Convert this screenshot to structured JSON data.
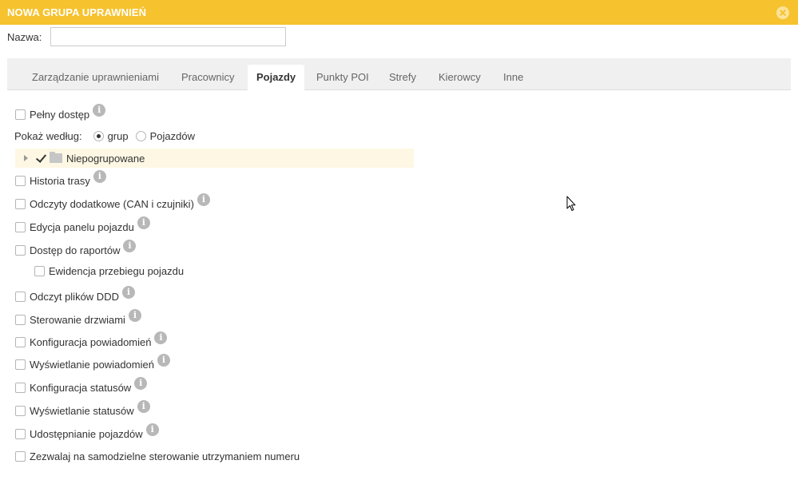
{
  "dialog": {
    "title": "NOWA GRUPA UPRAWNIEŃ",
    "name_label": "Nazwa:",
    "name_value": "",
    "name_placeholder": ""
  },
  "tabs": [
    {
      "label": "Zarządzanie uprawnieniami",
      "active": false
    },
    {
      "label": "Pracownicy",
      "active": false
    },
    {
      "label": "Pojazdy",
      "active": true
    },
    {
      "label": "Punkty POI",
      "active": false
    },
    {
      "label": "Strefy",
      "active": false
    },
    {
      "label": "Kierowcy",
      "active": false
    },
    {
      "label": "Inne",
      "active": false
    }
  ],
  "permissions": {
    "full_access": {
      "label": "Pełny dostęp",
      "checked": false
    },
    "show_by": {
      "label": "Pokaż według:",
      "options": [
        {
          "label": "grup",
          "selected": true
        },
        {
          "label": "Pojazdów",
          "selected": false
        }
      ]
    },
    "group": {
      "label": "Niepogrupowane",
      "checked": true
    },
    "items": [
      {
        "label": "Historia trasy",
        "checked": false
      },
      {
        "label": "Odczyty dodatkowe (CAN i czujniki)",
        "checked": false
      },
      {
        "label": "Edycja panelu pojazdu",
        "checked": false
      },
      {
        "label": "Dostęp do raportów",
        "checked": false
      },
      {
        "label": "Ewidencja przebiegu pojazdu",
        "checked": false
      },
      {
        "label": "Odczyt plików DDD",
        "checked": false
      },
      {
        "label": "Sterowanie drzwiami",
        "checked": false
      },
      {
        "label": "Konfiguracja powiadomień",
        "checked": false
      },
      {
        "label": "Wyświetlanie powiadomień",
        "checked": false
      },
      {
        "label": "Konfiguracja statusów",
        "checked": false
      },
      {
        "label": "Wyświetlanie statusów",
        "checked": false
      },
      {
        "label": "Udostępnianie pojazdów",
        "checked": false
      },
      {
        "label": "Zezwalaj na samodzielne sterowanie utrzymaniem numeru",
        "checked": false
      }
    ]
  },
  "icons": {
    "info": "info-icon",
    "close": "close-icon",
    "folder": "folder-icon"
  },
  "colors": {
    "header": "#f6c22d",
    "group_highlight": "#fdf7e3"
  }
}
